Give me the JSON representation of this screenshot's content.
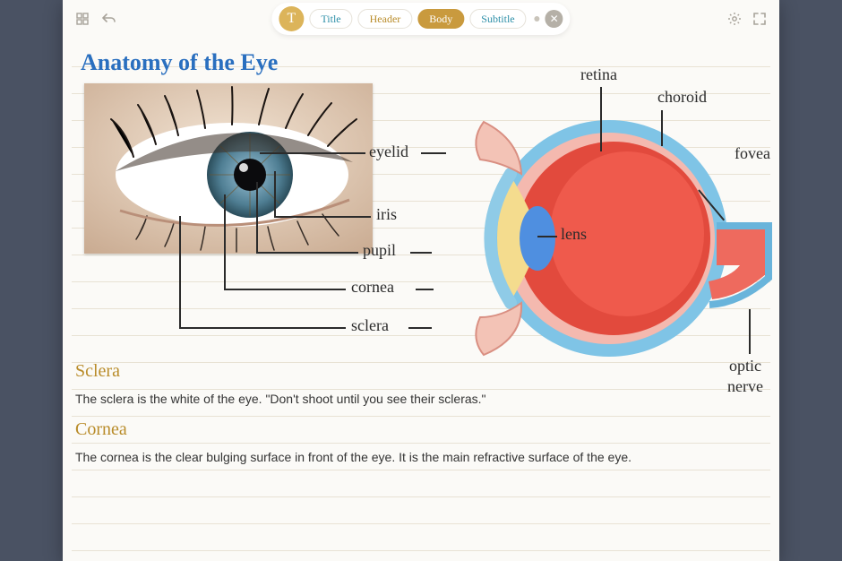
{
  "toolbar": {
    "title_pill": "Title",
    "header_pill": "Header",
    "body_pill": "Body",
    "subtitle_pill": "Subtitle"
  },
  "doc": {
    "title": "Anatomy of the Eye",
    "labels": {
      "eyelid": "eyelid",
      "iris": "iris",
      "pupil": "pupil",
      "cornea": "cornea",
      "sclera": "sclera",
      "retina": "retina",
      "choroid": "choroid",
      "fovea": "fovea",
      "lens": "lens",
      "optic_nerve_1": "optic",
      "optic_nerve_2": "nerve"
    },
    "sections": [
      {
        "header": "Sclera",
        "body": "The sclera is the white of the eye. \"Don't shoot until you see their scleras.\""
      },
      {
        "header": "Cornea",
        "body": "The cornea is the clear bulging surface in front of the eye. It is the main refractive surface of the eye."
      }
    ]
  }
}
